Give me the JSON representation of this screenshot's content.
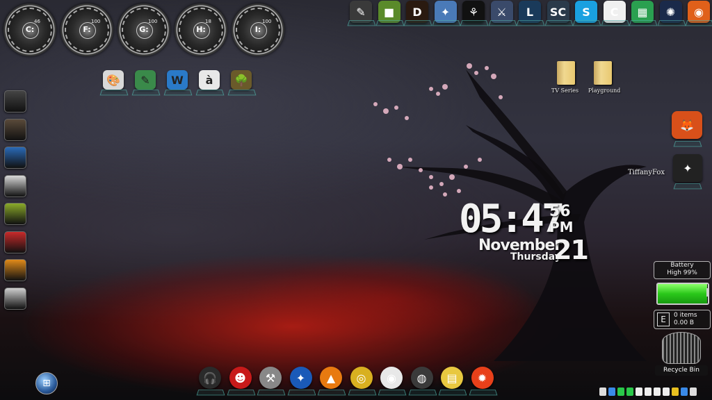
{
  "drives": [
    {
      "letter": "C:",
      "percent": "46"
    },
    {
      "letter": "F:",
      "percent": "100"
    },
    {
      "letter": "G:",
      "percent": "100"
    },
    {
      "letter": "H:",
      "percent": "18"
    },
    {
      "letter": "I:",
      "percent": "100"
    }
  ],
  "top_icons": [
    {
      "name": "editor-icon",
      "color": "#3a3a3a",
      "glyph": "✎"
    },
    {
      "name": "minecraft-icon",
      "color": "#5a8a2a",
      "glyph": "■"
    },
    {
      "name": "diablo-icon",
      "color": "#2a1a10",
      "glyph": "D"
    },
    {
      "name": "hearthstone-icon",
      "color": "#4a7ab8",
      "glyph": "✦"
    },
    {
      "name": "razer-icon",
      "color": "#111",
      "glyph": "⚘"
    },
    {
      "name": "warcraft-icon",
      "color": "#3a4a6a",
      "glyph": "⚔"
    },
    {
      "name": "league-icon",
      "color": "#1a3a5a",
      "glyph": "L"
    },
    {
      "name": "starcraft-icon",
      "color": "#2a3a4a",
      "glyph": "SC"
    },
    {
      "name": "skype-icon",
      "color": "#1aa0e0",
      "glyph": "S"
    },
    {
      "name": "crescent-icon",
      "color": "#f0f0f0",
      "glyph": "C"
    },
    {
      "name": "bluestacks-icon",
      "color": "#2aa050",
      "glyph": "▦"
    },
    {
      "name": "battlenet-icon",
      "color": "#1a2a4a",
      "glyph": "✺"
    },
    {
      "name": "origin-icon",
      "color": "#e0601a",
      "glyph": "◉"
    }
  ],
  "mid_icons": [
    {
      "name": "paint-icon",
      "color": "#d8d8d8",
      "glyph": "🎨"
    },
    {
      "name": "notes-icon",
      "color": "#3a8a4a",
      "glyph": "✎"
    },
    {
      "name": "word-icon",
      "color": "#2a7ac8",
      "glyph": "W"
    },
    {
      "name": "keyboard-icon",
      "color": "#e8e8e8",
      "glyph": "à"
    },
    {
      "name": "tree-icon",
      "color": "#6a5a2a",
      "glyph": "🌳"
    }
  ],
  "side_icons": [
    {
      "name": "dock-icon-1",
      "color": "#444"
    },
    {
      "name": "dock-icon-2",
      "color": "#5a4a3a"
    },
    {
      "name": "dock-icon-3",
      "color": "#2a6ab8"
    },
    {
      "name": "dock-icon-4",
      "color": "#d8d8d8"
    },
    {
      "name": "dock-icon-5",
      "color": "#8aaa2a"
    },
    {
      "name": "dock-icon-6",
      "color": "#c82a2a"
    },
    {
      "name": "dock-icon-7",
      "color": "#e08a1a"
    },
    {
      "name": "dock-icon-8",
      "color": "#cfcfcf"
    }
  ],
  "folders": [
    {
      "label": "TV Series"
    },
    {
      "label": "Playground"
    }
  ],
  "right_labels": {
    "tiffany": "TiffanyFox"
  },
  "clock": {
    "time": "05:47",
    "seconds": "56",
    "ampm": "PM",
    "month": "November",
    "weekday": "Thursday",
    "day": "21"
  },
  "battery": {
    "title": "Battery",
    "status": "High 99%",
    "fill": 0.99
  },
  "recycle": {
    "drive": "E",
    "items": "0 items",
    "size": "0.00 B",
    "label": "Recycle Bin"
  },
  "dock_icons": [
    {
      "name": "headphones-icon",
      "color": "#2a2a2a",
      "glyph": "🎧"
    },
    {
      "name": "robot-icon",
      "color": "#c81a1a",
      "glyph": "☻"
    },
    {
      "name": "tools-icon",
      "color": "#888",
      "glyph": "⚒"
    },
    {
      "name": "thunderbird-icon",
      "color": "#1a5ab8",
      "glyph": "✦"
    },
    {
      "name": "vlc-icon",
      "color": "#e87a10",
      "glyph": "▲"
    },
    {
      "name": "disc-icon",
      "color": "#d8b020",
      "glyph": "◎"
    },
    {
      "name": "eye-icon",
      "color": "#e8e8e8",
      "glyph": "◉"
    },
    {
      "name": "camera-icon",
      "color": "#3a3a3a",
      "glyph": "◍"
    },
    {
      "name": "stack-icon",
      "color": "#e8c840",
      "glyph": "▤"
    },
    {
      "name": "fire-icon",
      "color": "#e8401a",
      "glyph": "✹"
    }
  ],
  "tray_colors": [
    "#ddd",
    "#3a8ae8",
    "#2ac84a",
    "#2ac84a",
    "#eee",
    "#eee",
    "#eee",
    "#eee",
    "#e8c020",
    "#3a8ae8",
    "#ddd"
  ]
}
